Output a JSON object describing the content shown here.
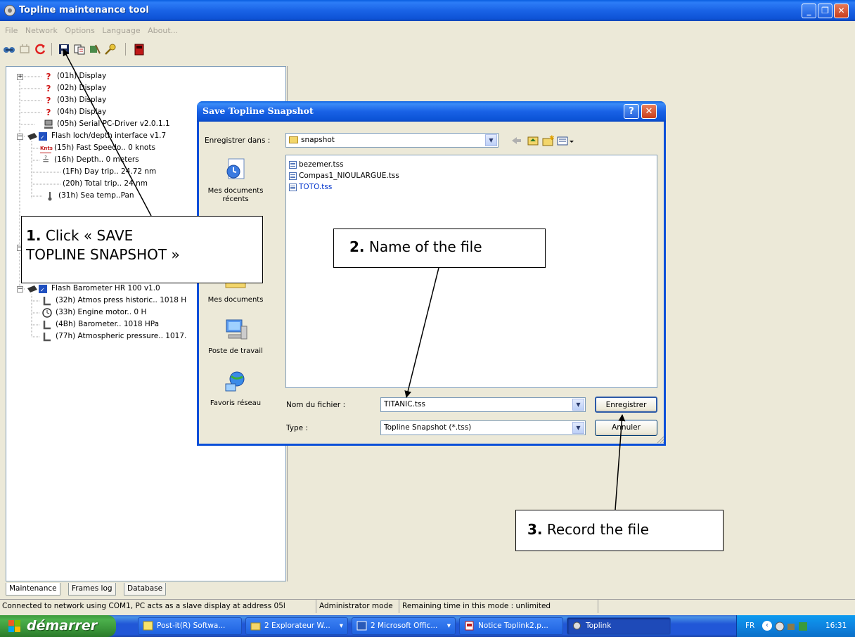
{
  "window": {
    "title": "Topline maintenance tool"
  },
  "menu": [
    "File",
    "Network",
    "Options",
    "Language",
    "About..."
  ],
  "tree": [
    {
      "label": "(01h) Display",
      "icon": "question-icon"
    },
    {
      "label": "(02h) Display",
      "icon": "question-icon"
    },
    {
      "label": "(03h) Display",
      "icon": "question-icon"
    },
    {
      "label": "(04h) Display",
      "icon": "question-icon"
    },
    {
      "label": "(05h) Serial PC-Driver v2.0.1.1",
      "icon": "computer-icon"
    },
    {
      "label": "Flash loch/depth interface  v1.7",
      "icon": "flash-module-icon"
    },
    {
      "label": "(15h) Fast Speedo.. 0 knots",
      "icon": "knots-icon"
    },
    {
      "label": "(16h) Depth.. 0 meters",
      "icon": "depth-icon"
    },
    {
      "label": "(1Fh) Day trip.. 24.72 nm",
      "icon": "none"
    },
    {
      "label": "(20h) Total trip.. 24 nm",
      "icon": "none"
    },
    {
      "label": "(31h) Sea temp..Pan",
      "icon": "thermometer-icon"
    },
    {
      "label": "Flash Barometer HR 100 v1.0",
      "icon": "flash-module-icon"
    },
    {
      "label": "(32h) Atmos press historic.. 1018 H",
      "icon": "pressure-icon"
    },
    {
      "label": "(33h) Engine motor.. 0 H",
      "icon": "clock-icon"
    },
    {
      "label": "(4Bh) Barometer.. 1018 HPa",
      "icon": "pressure-icon"
    },
    {
      "label": "(77h) Atmospheric pressure.. 1017.",
      "icon": "pressure-icon"
    }
  ],
  "tabs": [
    "Maintenance",
    "Frames log",
    "Database"
  ],
  "status": {
    "connection": "Connected to network using COM1, PC acts as a slave display at address 05l",
    "mode": "Administrator mode",
    "remaining": "Remaining time in this mode : unlimited"
  },
  "dialog": {
    "title": "Save Topline Snapshot",
    "save_in_label": "Enregistrer dans :",
    "save_in_value": "snapshot",
    "places": [
      "Mes documents récents",
      "Mes documents",
      "Poste de travail",
      "Favoris réseau"
    ],
    "files": [
      {
        "name": "bezemer.tss",
        "color": "#000000"
      },
      {
        "name": "Compas1_NIOULARGUE.tss",
        "color": "#000000"
      },
      {
        "name": "TOTO.tss",
        "color": "#0033cc"
      }
    ],
    "filename_label": "Nom du fichier :",
    "filename_value": "TITANIC.tss",
    "type_label": "Type :",
    "type_value": "Topline Snapshot (*.tss)",
    "save_button": "Enregistrer",
    "cancel_button": "Annuler",
    "help": "?"
  },
  "callouts": {
    "step1_num": "1.",
    "step1_text1": "Click « SAVE",
    "step1_text2": "TOPLINE SNAPSHOT »",
    "step2_num": "2.",
    "step2_text": "Name of the file",
    "step3_num": "3.",
    "step3_text": "Record  the file"
  },
  "taskbar": {
    "start": "démarrer",
    "tasks": [
      "Post-it(R) Softwa...",
      "2 Explorateur W...",
      "2 Microsoft Offic...",
      "Notice Toplink2.p...",
      "Toplink"
    ],
    "lang": "FR",
    "clock": "16:31"
  }
}
